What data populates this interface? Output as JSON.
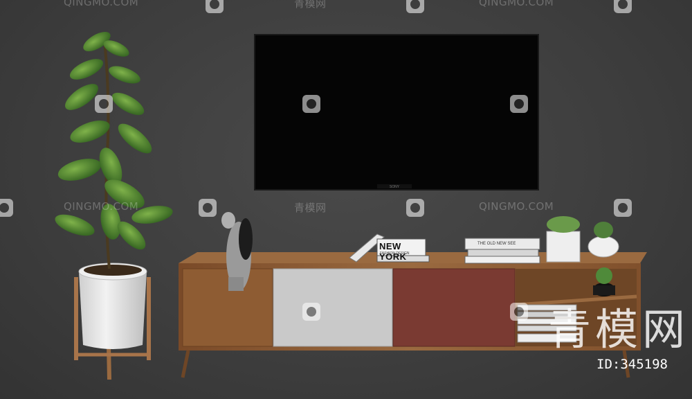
{
  "scene": {
    "background": "#3d3d3d",
    "objects": [
      "wall-mounted-tv",
      "tv-console-cabinet",
      "potted-fiddle-leaf-plant",
      "sculpture-figurine",
      "book-stack",
      "succulent-pots"
    ]
  },
  "watermark": {
    "site_text": "QINGMO.COM",
    "cn_text": "青模网",
    "big_logo_text": "青模网",
    "id_label": "ID:345198"
  },
  "books": {
    "new_york_title": "NEW YORK",
    "new_york_subtitle": "FASHION DESIGN",
    "right_book_title": "THE OLD NEW SEE"
  },
  "tv": {
    "brand": "SONY"
  },
  "colors": {
    "wood": "#8a5a34",
    "panel_gray": "#c9c9c9",
    "panel_rust": "#7a3a32",
    "pot_white": "#e8e8e8",
    "leaf_green": "#3f7a2a"
  }
}
